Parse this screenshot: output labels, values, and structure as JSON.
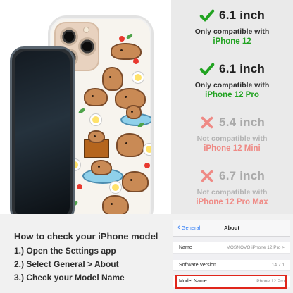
{
  "compatibility": [
    {
      "status": "compatible",
      "icon": "check-icon",
      "size": "6.1 inch",
      "note": "Only compatible with",
      "model": "iPhone 12"
    },
    {
      "status": "compatible",
      "icon": "check-icon",
      "size": "6.1 inch",
      "note": "Only compatible with",
      "model": "iPhone 12 Pro"
    },
    {
      "status": "incompatible",
      "icon": "cross-icon",
      "size": "5.4 inch",
      "note": "Not compatible with",
      "model": "iPhone 12 Mini"
    },
    {
      "status": "incompatible",
      "icon": "cross-icon",
      "size": "6.7 inch",
      "note": "Not compatible with",
      "model": "iPhone 12 Pro Max"
    }
  ],
  "howto": {
    "title": "How to check your iPhone model",
    "steps": [
      "1.) Open the Settings app",
      "2.) Select General > About",
      "3.) Check your Model Name"
    ]
  },
  "settings": {
    "back_label": "General",
    "title": "About",
    "rows": [
      {
        "label": "Name",
        "value": "MOSNOVO iPhone 12 Pro >"
      },
      {
        "label": "Software Version",
        "value": "14.7.1"
      },
      {
        "label": "Model Name",
        "value": "iPhone 12 Pro"
      }
    ]
  },
  "colors": {
    "check": "#21a321",
    "cross": "#ef8a85",
    "highlight": "#e0261b",
    "ios_link": "#2f7cf6"
  }
}
